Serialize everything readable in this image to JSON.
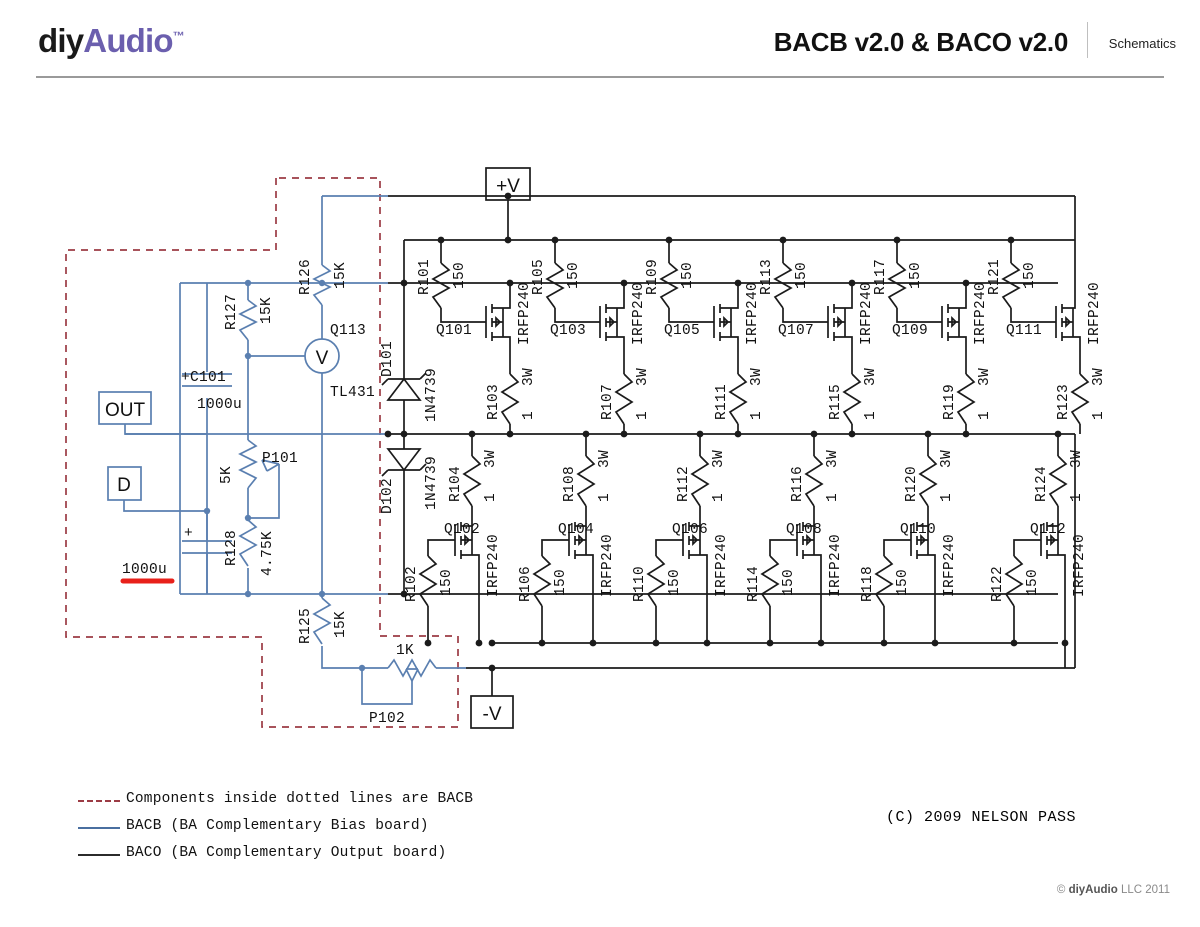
{
  "header": {
    "logo_diy": "diy",
    "logo_audio": "Audio",
    "logo_tm": "™",
    "title": "BACB v2.0 & BACO v2.0",
    "subtitle": "Schematics"
  },
  "footer": {
    "copyright": "(C) 2009 NELSON PASS",
    "diyaudio_mark": "©",
    "diyaudio_name": "diyAudio",
    "diyaudio_rest": "LLC 2011"
  },
  "legend": [
    {
      "style": "dashed-red",
      "text": "Components inside dotted lines are BACB"
    },
    {
      "style": "solid-blue",
      "text": "BACB (BA Complementary Bias board)"
    },
    {
      "style": "solid-black",
      "text": "BACO (BA Complementary Output board)"
    }
  ],
  "colors": {
    "bacb_wire": "#5a7fb0",
    "baco_wire": "#1b1b1b",
    "dotted_boundary": "#9c3b44",
    "logo_accent": "#6b5fae",
    "red_marker": "#e8201a"
  },
  "terminals": [
    {
      "name": "plus-v",
      "label": "+V"
    },
    {
      "name": "minus-v",
      "label": "-V"
    },
    {
      "name": "out",
      "label": "OUT"
    },
    {
      "name": "d",
      "label": "D"
    }
  ],
  "bias_board": {
    "resistors": [
      {
        "ref": "R126",
        "value": "15K"
      },
      {
        "ref": "R127",
        "value": "15K"
      },
      {
        "ref": "R125",
        "value": "15K"
      },
      {
        "ref": "R128",
        "value": "4.75K"
      }
    ],
    "potentiometers": [
      {
        "ref": "P101",
        "value": "5K"
      },
      {
        "ref": "P102",
        "value": "1K"
      }
    ],
    "capacitors": [
      {
        "ref": "+C101",
        "value": "1000u"
      },
      {
        "ref": "",
        "value": "1000u",
        "polarity": "+",
        "marked": true
      }
    ],
    "shunt_regulator": {
      "ref": "Q113",
      "part": "TL431",
      "symbol": "V"
    }
  },
  "zeners": [
    {
      "ref": "D101",
      "part": "1N4739"
    },
    {
      "ref": "D102",
      "part": "1N4739"
    }
  ],
  "output_board": {
    "mosfet_part": "IRFP240",
    "gate_resistor_value": "150",
    "source_resistor_value": "1",
    "source_resistor_power": "3W",
    "columns": [
      {
        "top_mosfet": "Q101",
        "top_gate_res": "R101",
        "top_src_res": "R103",
        "bot_mosfet": "Q102",
        "bot_gate_res": "R102",
        "bot_src_res": "R104"
      },
      {
        "top_mosfet": "Q103",
        "top_gate_res": "R105",
        "top_src_res": "R107",
        "bot_mosfet": "Q104",
        "bot_gate_res": "R106",
        "bot_src_res": "R108"
      },
      {
        "top_mosfet": "Q105",
        "top_gate_res": "R109",
        "top_src_res": "R111",
        "bot_mosfet": "Q106",
        "bot_gate_res": "R110",
        "bot_src_res": "R112"
      },
      {
        "top_mosfet": "Q107",
        "top_gate_res": "R113",
        "top_src_res": "R115",
        "bot_mosfet": "Q108",
        "bot_gate_res": "R114",
        "bot_src_res": "R116"
      },
      {
        "top_mosfet": "Q109",
        "top_gate_res": "R117",
        "top_src_res": "R119",
        "bot_mosfet": "Q110",
        "bot_gate_res": "R118",
        "bot_src_res": "R120"
      },
      {
        "top_mosfet": "Q111",
        "top_gate_res": "R121",
        "top_src_res": "R123",
        "bot_mosfet": "Q112",
        "bot_gate_res": "R122",
        "bot_src_res": "R124"
      }
    ]
  }
}
